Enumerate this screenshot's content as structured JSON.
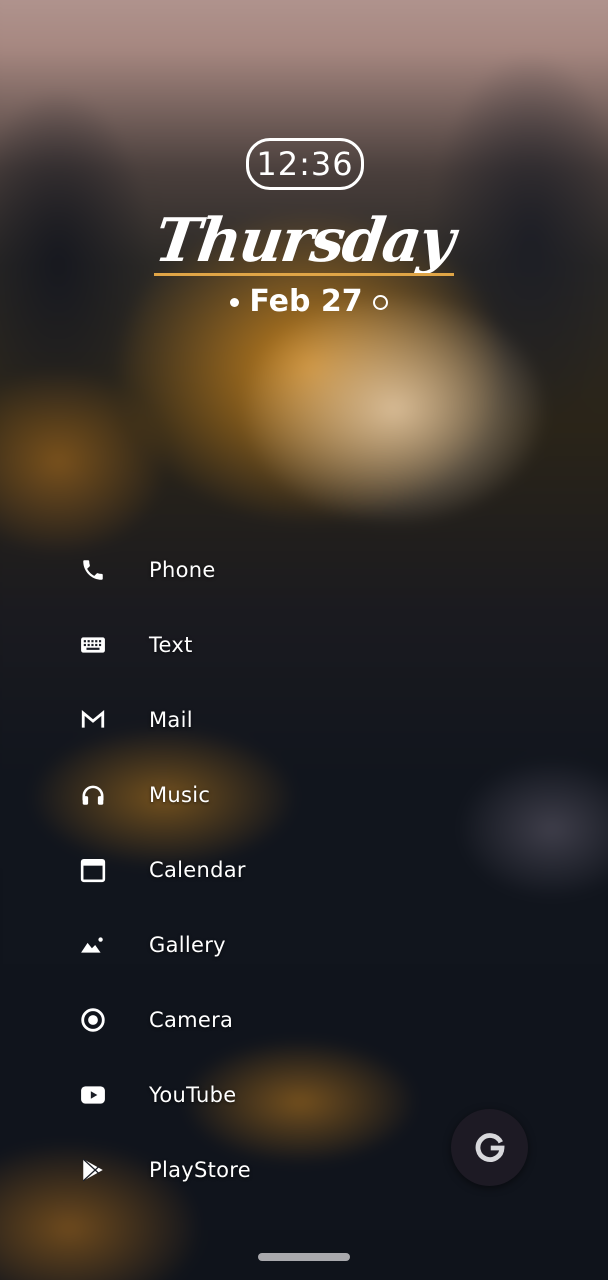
{
  "clock": {
    "time": "12:36"
  },
  "date": {
    "weekday": "Thursday",
    "day": "Feb 27"
  },
  "apps": [
    {
      "label": "Phone",
      "icon": "phone-icon"
    },
    {
      "label": "Text",
      "icon": "keyboard-icon"
    },
    {
      "label": "Mail",
      "icon": "mail-icon"
    },
    {
      "label": "Music",
      "icon": "headphones-icon"
    },
    {
      "label": "Calendar",
      "icon": "calendar-icon"
    },
    {
      "label": "Gallery",
      "icon": "gallery-icon"
    },
    {
      "label": "Camera",
      "icon": "camera-icon"
    },
    {
      "label": "YouTube",
      "icon": "youtube-icon"
    },
    {
      "label": "PlayStore",
      "icon": "playstore-icon"
    }
  ],
  "colors": {
    "accent_underline": "#e0a546",
    "fab_background": "#1d1a24",
    "text": "#ffffff"
  }
}
